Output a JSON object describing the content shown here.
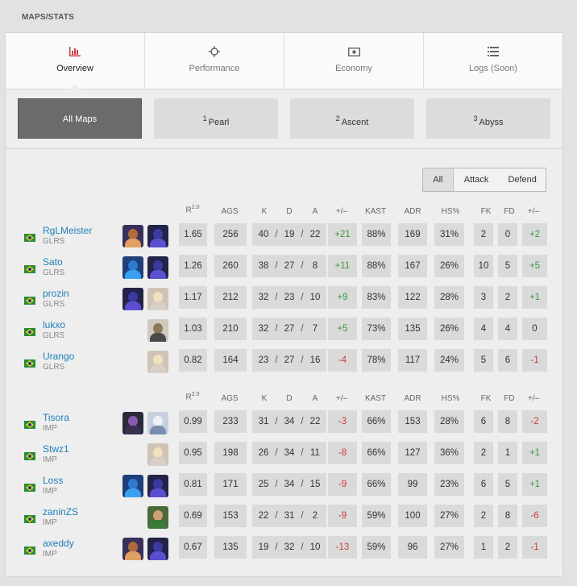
{
  "section_title": "MAPS/STATS",
  "tabs": [
    {
      "label": "Overview",
      "icon": "bar-chart-icon",
      "active": true
    },
    {
      "label": "Performance",
      "icon": "crosshair-icon",
      "active": false
    },
    {
      "label": "Economy",
      "icon": "money-icon",
      "active": false
    },
    {
      "label": "Logs (Soon)",
      "icon": "list-icon",
      "active": false
    }
  ],
  "maps": [
    {
      "num": "",
      "label": "All Maps",
      "active": true
    },
    {
      "num": "1",
      "label": "Pearl",
      "active": false
    },
    {
      "num": "2",
      "label": "Ascent",
      "active": false
    },
    {
      "num": "3",
      "label": "Abyss",
      "active": false
    }
  ],
  "side_filter": [
    "All",
    "Attack",
    "Defend"
  ],
  "headers": {
    "rating": "R",
    "rating_sup": "2.0",
    "acs": "AGS",
    "k": "K",
    "d": "D",
    "a": "A",
    "pm": "+/–",
    "kast": "KAST",
    "adr": "ADR",
    "hs": "HS%",
    "fk": "FK",
    "fd": "FD",
    "fpm": "+/–"
  },
  "colors": {
    "positive": "#3d9a43",
    "negative": "#d13b3b",
    "link": "#1f7fb8"
  },
  "teams": [
    {
      "players": [
        {
          "name": "RgLMeister",
          "team": "GLRS",
          "agents": [
            "breach-agent-icon",
            "omen-agent-icon"
          ],
          "rating": "1.65",
          "acs": "256",
          "k": "40",
          "d": "19",
          "a": "22",
          "pm": "+21",
          "kast": "88%",
          "adr": "169",
          "hs": "31%",
          "fk": "2",
          "fd": "0",
          "fpm": "+2"
        },
        {
          "name": "Sato",
          "team": "GLRS",
          "agents": [
            "neon-agent-icon",
            "omen-agent-icon"
          ],
          "rating": "1.26",
          "acs": "260",
          "k": "38",
          "d": "27",
          "a": "8",
          "pm": "+11",
          "kast": "88%",
          "adr": "167",
          "hs": "26%",
          "fk": "10",
          "fd": "5",
          "fpm": "+5"
        },
        {
          "name": "prozin",
          "team": "GLRS",
          "agents": [
            "omen-agent-icon",
            "sage-agent-icon"
          ],
          "rating": "1.17",
          "acs": "212",
          "k": "32",
          "d": "23",
          "a": "10",
          "pm": "+9",
          "kast": "83%",
          "adr": "122",
          "hs": "28%",
          "fk": "3",
          "fd": "2",
          "fpm": "+1"
        },
        {
          "name": "lukxo",
          "team": "GLRS",
          "agents": [
            "cypher-agent-icon"
          ],
          "rating": "1.03",
          "acs": "210",
          "k": "32",
          "d": "27",
          "a": "7",
          "pm": "+5",
          "kast": "73%",
          "adr": "135",
          "hs": "26%",
          "fk": "4",
          "fd": "4",
          "fpm": "0"
        },
        {
          "name": "Urango",
          "team": "GLRS",
          "agents": [
            "sage-agent-icon"
          ],
          "rating": "0.82",
          "acs": "164",
          "k": "23",
          "d": "27",
          "a": "16",
          "pm": "-4",
          "kast": "78%",
          "adr": "117",
          "hs": "24%",
          "fk": "5",
          "fd": "6",
          "fpm": "-1"
        }
      ]
    },
    {
      "players": [
        {
          "name": "Tisora",
          "team": "IMP",
          "agents": [
            "clove-agent-icon",
            "jett-agent-icon"
          ],
          "rating": "0.99",
          "acs": "233",
          "k": "31",
          "d": "34",
          "a": "22",
          "pm": "-3",
          "kast": "66%",
          "adr": "153",
          "hs": "28%",
          "fk": "6",
          "fd": "8",
          "fpm": "-2"
        },
        {
          "name": "Stwz1",
          "team": "IMP",
          "agents": [
            "sage-agent-icon"
          ],
          "rating": "0.95",
          "acs": "198",
          "k": "26",
          "d": "34",
          "a": "11",
          "pm": "-8",
          "kast": "66%",
          "adr": "127",
          "hs": "36%",
          "fk": "2",
          "fd": "1",
          "fpm": "+1"
        },
        {
          "name": "Loss",
          "team": "IMP",
          "agents": [
            "neon-agent-icon",
            "omen-agent-icon"
          ],
          "rating": "0.81",
          "acs": "171",
          "k": "25",
          "d": "34",
          "a": "15",
          "pm": "-9",
          "kast": "66%",
          "adr": "99",
          "hs": "23%",
          "fk": "6",
          "fd": "5",
          "fpm": "+1"
        },
        {
          "name": "zaninZS",
          "team": "IMP",
          "agents": [
            "gekko-agent-icon"
          ],
          "rating": "0.69",
          "acs": "153",
          "k": "22",
          "d": "31",
          "a": "2",
          "pm": "-9",
          "kast": "59%",
          "adr": "100",
          "hs": "27%",
          "fk": "2",
          "fd": "8",
          "fpm": "-6"
        },
        {
          "name": "axeddy",
          "team": "IMP",
          "agents": [
            "breach-agent-icon",
            "omen-agent-icon"
          ],
          "rating": "0.67",
          "acs": "135",
          "k": "19",
          "d": "32",
          "a": "10",
          "pm": "-13",
          "kast": "59%",
          "adr": "96",
          "hs": "27%",
          "fk": "1",
          "fd": "2",
          "fpm": "-1"
        }
      ]
    }
  ]
}
